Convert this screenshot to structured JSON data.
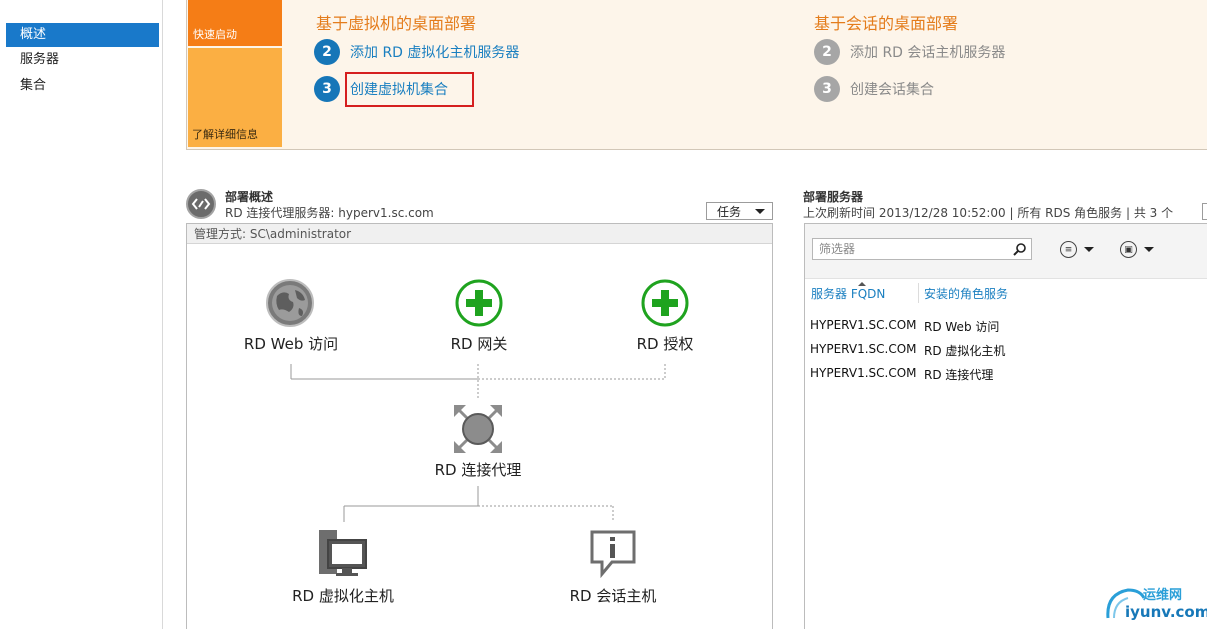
{
  "sidebar": {
    "items": [
      {
        "label": "概述",
        "active": true
      },
      {
        "label": "服务器",
        "active": false
      },
      {
        "label": "集合",
        "active": false
      }
    ]
  },
  "quickstart": {
    "tile_label": "快速启动",
    "learn_more_label": "了解详细信息",
    "vm_section": {
      "title": "基于虚拟机的桌面部署",
      "steps": [
        {
          "num": "2",
          "label": "添加 RD 虚拟化主机服务器"
        },
        {
          "num": "3",
          "label": "创建虚拟机集合"
        }
      ]
    },
    "session_section": {
      "title": "基于会话的桌面部署",
      "steps": [
        {
          "num": "2",
          "label": "添加 RD 会话主机服务器"
        },
        {
          "num": "3",
          "label": "创建会话集合"
        }
      ]
    }
  },
  "overview": {
    "title": "部署概述",
    "subtitle": "RD 连接代理服务器: hyperv1.sc.com",
    "tasks_label": "任务",
    "managed_by": "管理方式: SC\\administrator",
    "nodes": {
      "web_access": "RD Web 访问",
      "gateway": "RD 网关",
      "licensing": "RD 授权",
      "broker": "RD 连接代理",
      "virtualization_host": "RD 虚拟化主机",
      "session_host": "RD 会话主机"
    }
  },
  "servers": {
    "title": "部署服务器",
    "subtitle": "上次刷新时间 2013/12/28 10:52:00 | 所有 RDS 角色服务  | 共 3 个",
    "filter_placeholder": "筛选器",
    "columns": [
      "服务器 FQDN",
      "安装的角色服务"
    ],
    "rows": [
      [
        "HYPERV1.SC.COM",
        "RD Web 访问"
      ],
      [
        "HYPERV1.SC.COM",
        "RD 虚拟化主机"
      ],
      [
        "HYPERV1.SC.COM",
        "RD 连接代理"
      ]
    ]
  },
  "watermark": {
    "line1": "运维网",
    "line2": "iyunv.com"
  },
  "colors": {
    "accent_blue": "#1979ca",
    "orange": "#f57d16",
    "light_orange": "#fbaf43",
    "green": "#1fa31f",
    "highlight_red": "#d51f1f"
  }
}
